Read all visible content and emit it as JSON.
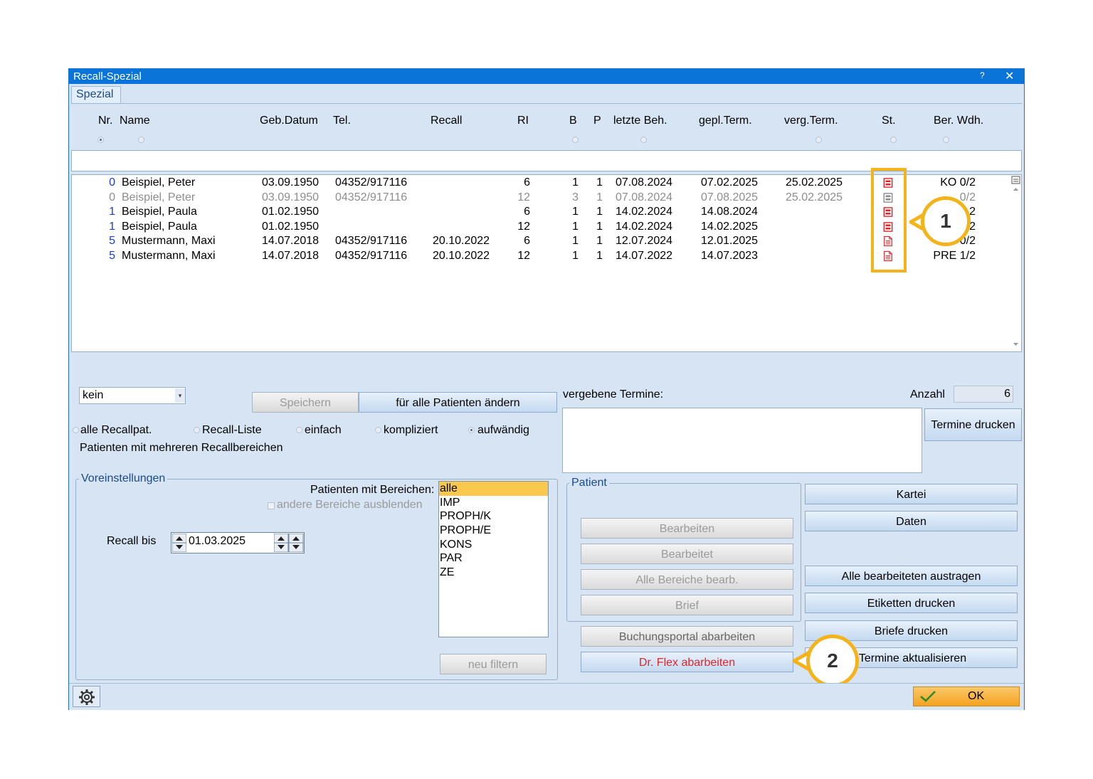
{
  "window": {
    "title": "Recall-Spezial",
    "help": "?",
    "close": "✕"
  },
  "tab": {
    "label": "Spezial"
  },
  "columns": [
    "Nr.",
    "Name",
    "Geb.Datum",
    "Tel.",
    "Recall",
    "RI",
    "B",
    "P",
    "letzte Beh.",
    "gepl.Term.",
    "verg.Term.",
    "St.",
    "Ber. Wdh."
  ],
  "rows": [
    {
      "nr": "0",
      "name": "Beispiel, Peter",
      "geb": "03.09.1950",
      "tel": "04352/917116",
      "recall": "",
      "ri": "6",
      "b": "1",
      "p": "1",
      "letzte": "07.08.2024",
      "gepl": "07.02.2025",
      "verg": "25.02.2025",
      "status": "red",
      "ber": "KO 0/2",
      "grey": false
    },
    {
      "nr": "0",
      "name": "Beispiel, Peter",
      "geb": "03.09.1950",
      "tel": "04352/917116",
      "recall": "",
      "ri": "12",
      "b": "3",
      "p": "1",
      "letzte": "07.08.2024",
      "gepl": "07.08.2025",
      "verg": "25.02.2025",
      "status": "grey",
      "ber": "0/2",
      "grey": true
    },
    {
      "nr": "1",
      "name": "Beispiel, Paula",
      "geb": "01.02.1950",
      "tel": "",
      "recall": "",
      "ri": "6",
      "b": "1",
      "p": "1",
      "letzte": "14.02.2024",
      "gepl": "14.08.2024",
      "verg": "",
      "status": "red",
      "ber": "2",
      "grey": false
    },
    {
      "nr": "1",
      "name": "Beispiel, Paula",
      "geb": "01.02.1950",
      "tel": "",
      "recall": "",
      "ri": "12",
      "b": "1",
      "p": "1",
      "letzte": "14.02.2024",
      "gepl": "14.02.2025",
      "verg": "",
      "status": "red",
      "ber": "2",
      "grey": false
    },
    {
      "nr": "5",
      "name": "Mustermann, Maxi",
      "geb": "14.07.2018",
      "tel": "04352/917116",
      "recall": "20.10.2022",
      "ri": "6",
      "b": "1",
      "p": "1",
      "letzte": "12.07.2024",
      "gepl": "12.01.2025",
      "verg": "",
      "status": "doc",
      "ber": "0/2",
      "grey": false
    },
    {
      "nr": "5",
      "name": "Mustermann, Maxi",
      "geb": "14.07.2018",
      "tel": "04352/917116",
      "recall": "20.10.2022",
      "ri": "12",
      "b": "1",
      "p": "1",
      "letzte": "14.07.2022",
      "gepl": "14.07.2023",
      "verg": "",
      "status": "doc",
      "ber": "PRE 1/2",
      "grey": false
    }
  ],
  "callouts": [
    "1",
    "2"
  ],
  "controls": {
    "dropdown_value": "kein",
    "save_label": "Speichern",
    "change_all_label": "für alle Patienten ändern",
    "assigned_label": "vergebene Termine:",
    "count_label": "Anzahl",
    "count_value": "6",
    "print_appointments": "Termine drucken",
    "radio_options": [
      "alle Recallpat.",
      "Recall-Liste",
      "einfach",
      "kompliziert",
      "aufwändig"
    ],
    "multi_area_label": "Patienten mit mehreren Recallbereichen"
  },
  "presets": {
    "title": "Voreinstellungen",
    "areas_label": "Patienten mit Bereichen:",
    "hide_other": "andere Bereiche ausblenden",
    "recall_until_label": "Recall bis",
    "recall_until_value": "01.03.2025",
    "areas": [
      "alle",
      "IMP",
      "PROPH/K",
      "PROPH/E",
      "KONS",
      "PAR",
      "ZE"
    ],
    "refilter": "neu filtern"
  },
  "patient": {
    "title": "Patient",
    "edit": "Bearbeiten",
    "edited": "Bearbeitet",
    "edit_all": "Alle Bereiche bearb.",
    "letter": "Brief",
    "booking": "Buchungsportal abarbeiten",
    "drflex": "Dr. Flex abarbeiten"
  },
  "right_buttons": {
    "kartei": "Kartei",
    "daten": "Daten",
    "remove_edited": "Alle bearbeiteten austragen",
    "labels": "Etiketten drucken",
    "letters": "Briefe drucken",
    "update": "Termine aktualisieren"
  },
  "ok_label": "OK",
  "colors": {
    "accent": "#0a74d8",
    "callout": "#f4b21b",
    "status_red": "#e0262b",
    "drflex": "#e0262b",
    "link_blue": "#1a3fcf"
  }
}
